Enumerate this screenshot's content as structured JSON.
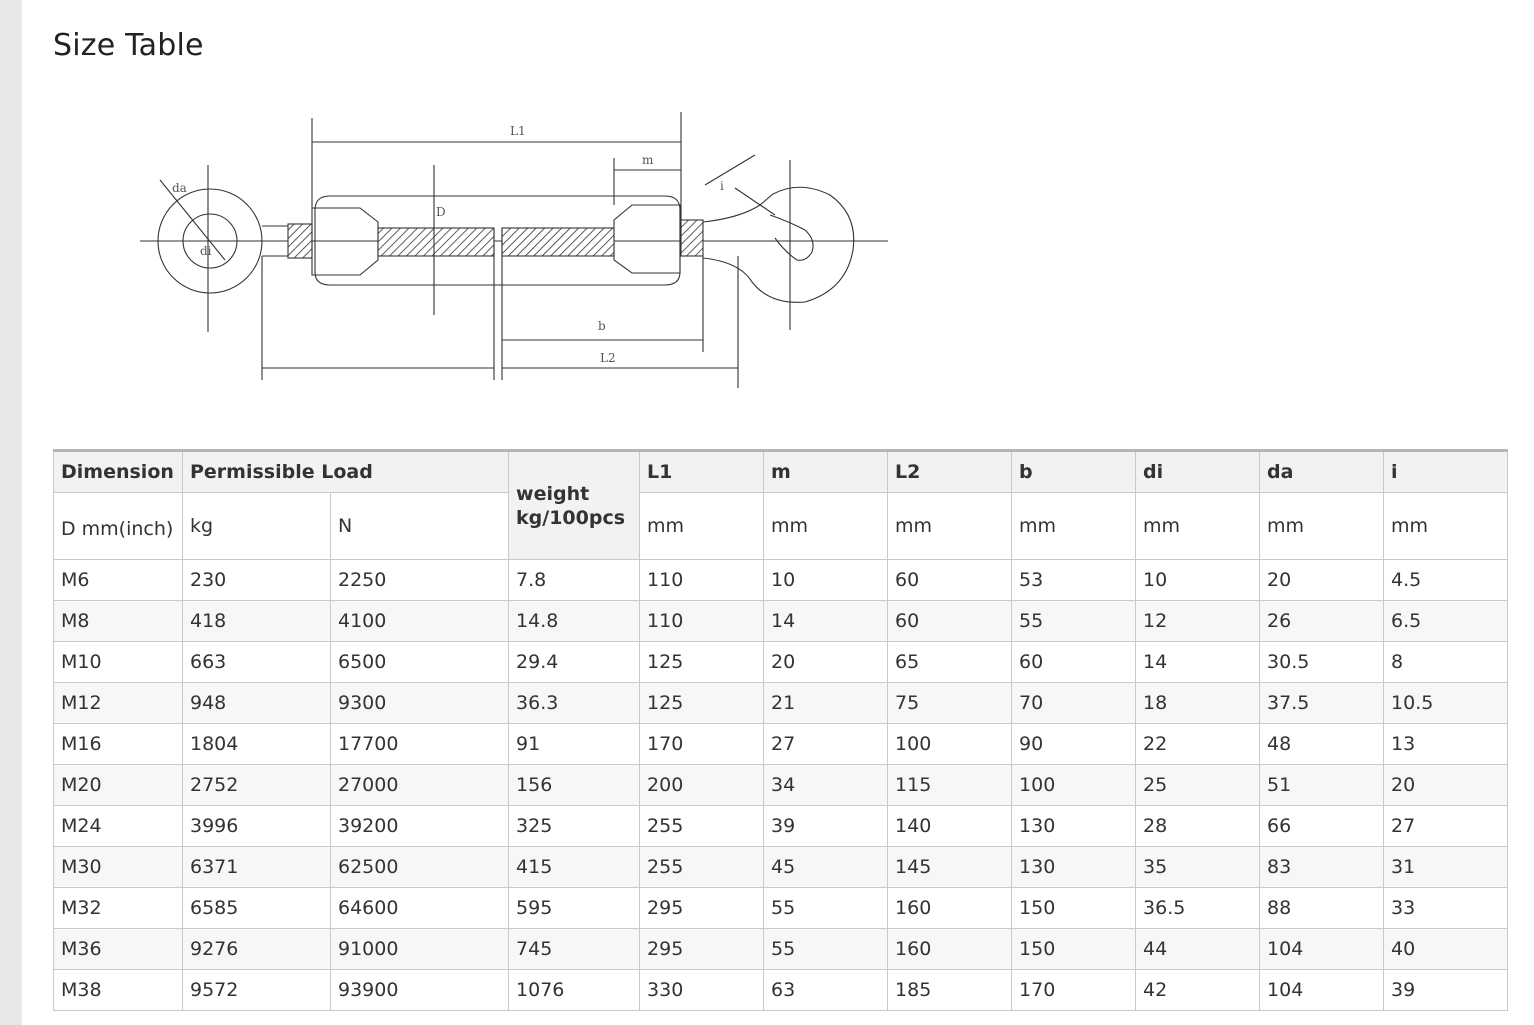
{
  "page": {
    "title": "Size Table"
  },
  "drawing": {
    "labels": {
      "l1": "L1",
      "m": "m",
      "d": "D",
      "di": "di",
      "da": "da",
      "i": "i",
      "b": "b",
      "l2": "L2"
    }
  },
  "table": {
    "header": {
      "dimension": "Dimension",
      "permissible_load": "Permissible Load",
      "weight": "weight kg/100pcs",
      "l1": "L1",
      "m": "m",
      "l2": "L2",
      "b": "b",
      "di": "di",
      "da": "da",
      "i": "i"
    },
    "units": {
      "dimension": "D mm(inch)",
      "kg": "kg",
      "n": "N",
      "l1": "mm",
      "m": "mm",
      "l2": "mm",
      "b": "mm",
      "di": "mm",
      "da": "mm",
      "i": "mm"
    },
    "rows": [
      [
        "M6",
        "230",
        "2250",
        "7.8",
        "110",
        "10",
        "60",
        "53",
        "10",
        "20",
        "4.5"
      ],
      [
        "M8",
        "418",
        "4100",
        "14.8",
        "110",
        "14",
        "60",
        "55",
        "12",
        "26",
        "6.5"
      ],
      [
        "M10",
        "663",
        "6500",
        "29.4",
        "125",
        "20",
        "65",
        "60",
        "14",
        "30.5",
        "8"
      ],
      [
        "M12",
        "948",
        "9300",
        "36.3",
        "125",
        "21",
        "75",
        "70",
        "18",
        "37.5",
        "10.5"
      ],
      [
        "M16",
        "1804",
        "17700",
        "91",
        "170",
        "27",
        "100",
        "90",
        "22",
        "48",
        "13"
      ],
      [
        "M20",
        "2752",
        "27000",
        "156",
        "200",
        "34",
        "115",
        "100",
        "25",
        "51",
        "20"
      ],
      [
        "M24",
        "3996",
        "39200",
        "325",
        "255",
        "39",
        "140",
        "130",
        "28",
        "66",
        "27"
      ],
      [
        "M30",
        "6371",
        "62500",
        "415",
        "255",
        "45",
        "145",
        "130",
        "35",
        "83",
        "31"
      ],
      [
        "M32",
        "6585",
        "64600",
        "595",
        "295",
        "55",
        "160",
        "150",
        "36.5",
        "88",
        "33"
      ],
      [
        "M36",
        "9276",
        "91000",
        "745",
        "295",
        "55",
        "160",
        "150",
        "44",
        "104",
        "40"
      ],
      [
        "M38",
        "9572",
        "93900",
        "1076",
        "330",
        "63",
        "185",
        "170",
        "42",
        "104",
        "39"
      ]
    ]
  }
}
